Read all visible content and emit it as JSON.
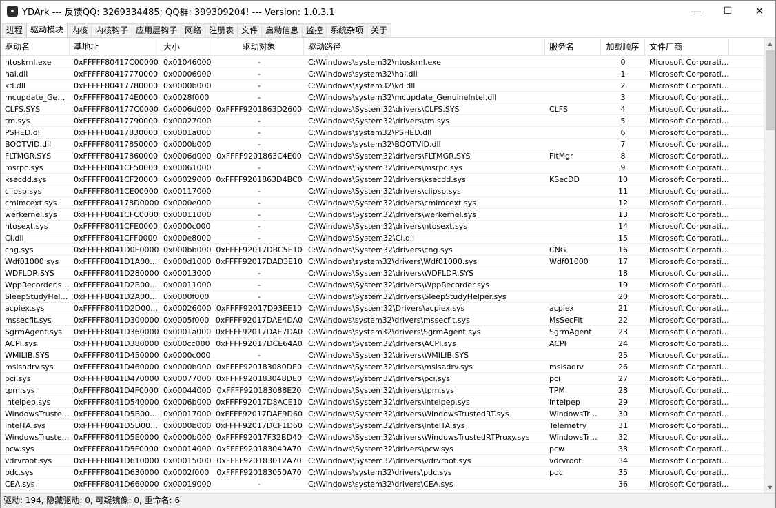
{
  "title": "YDArk --- 反馈QQ: 3269334485; QQ群: 399309204! --- Version: 1.0.3.1",
  "window_controls": {
    "minimize": "—",
    "maximize": "☐",
    "close": "✕"
  },
  "tabs": [
    "进程",
    "驱动模块",
    "内核",
    "内核钩子",
    "应用层钩子",
    "网络",
    "注册表",
    "文件",
    "启动信息",
    "监控",
    "系统杂项",
    "关于"
  ],
  "active_tab": "驱动模块",
  "columns": [
    "驱动名",
    "基地址",
    "大小",
    "驱动对象",
    "驱动路径",
    "服务名",
    "加载顺序",
    "文件厂商",
    ""
  ],
  "rows": [
    [
      "ntoskrnl.exe",
      "0xFFFFF80417C00000",
      "0x01046000",
      "-",
      "C:\\Windows\\system32\\ntoskrnl.exe",
      "",
      "0",
      "Microsoft Corporation"
    ],
    [
      "hal.dll",
      "0xFFFFF80417770000",
      "0x00006000",
      "-",
      "C:\\Windows\\system32\\hal.dll",
      "",
      "1",
      "Microsoft Corporation"
    ],
    [
      "kd.dll",
      "0xFFFFF80417780000",
      "0x0000b000",
      "-",
      "C:\\Windows\\system32\\kd.dll",
      "",
      "2",
      "Microsoft Corporation"
    ],
    [
      "mcupdate_GenuineIntel.dll",
      "0xFFFFF804174E0000",
      "0x0028f000",
      "-",
      "C:\\Windows\\system32\\mcupdate_GenuineIntel.dll",
      "",
      "3",
      "Microsoft Corporation"
    ],
    [
      "CLFS.SYS",
      "0xFFFFF804177C0000",
      "0x0006d000",
      "0xFFFF9201863D2600",
      "C:\\Windows\\System32\\drivers\\CLFS.SYS",
      "CLFS",
      "4",
      "Microsoft Corporation"
    ],
    [
      "tm.sys",
      "0xFFFFF80417790000",
      "0x00027000",
      "-",
      "C:\\Windows\\System32\\drivers\\tm.sys",
      "",
      "5",
      "Microsoft Corporation"
    ],
    [
      "PSHED.dll",
      "0xFFFFF80417830000",
      "0x0001a000",
      "-",
      "C:\\Windows\\system32\\PSHED.dll",
      "",
      "6",
      "Microsoft Corporation"
    ],
    [
      "BOOTVID.dll",
      "0xFFFFF80417850000",
      "0x0000b000",
      "-",
      "C:\\Windows\\system32\\BOOTVID.dll",
      "",
      "7",
      "Microsoft Corporation"
    ],
    [
      "FLTMGR.SYS",
      "0xFFFFF80417860000",
      "0x0006d000",
      "0xFFFF9201863C4E00",
      "C:\\Windows\\System32\\drivers\\FLTMGR.SYS",
      "FltMgr",
      "8",
      "Microsoft Corporation"
    ],
    [
      "msrpc.sys",
      "0xFFFFF8041CF50000",
      "0x00061000",
      "-",
      "C:\\Windows\\System32\\drivers\\msrpc.sys",
      "",
      "9",
      "Microsoft Corporation"
    ],
    [
      "ksecdd.sys",
      "0xFFFFF8041CF20000",
      "0x00029000",
      "0xFFFF9201863D4BC0",
      "C:\\Windows\\System32\\drivers\\ksecdd.sys",
      "KSecDD",
      "10",
      "Microsoft Corporation"
    ],
    [
      "clipsp.sys",
      "0xFFFFF8041CE00000",
      "0x00117000",
      "-",
      "C:\\Windows\\System32\\drivers\\clipsp.sys",
      "",
      "11",
      "Microsoft Corporation"
    ],
    [
      "cmimcext.sys",
      "0xFFFFF804178D0000",
      "0x0000e000",
      "-",
      "C:\\Windows\\System32\\drivers\\cmimcext.sys",
      "",
      "12",
      "Microsoft Corporation"
    ],
    [
      "werkernel.sys",
      "0xFFFFF8041CFC0000",
      "0x00011000",
      "-",
      "C:\\Windows\\System32\\drivers\\werkernel.sys",
      "",
      "13",
      "Microsoft Corporation"
    ],
    [
      "ntosext.sys",
      "0xFFFFF8041CFE0000",
      "0x0000c000",
      "-",
      "C:\\Windows\\System32\\drivers\\ntosext.sys",
      "",
      "14",
      "Microsoft Corporation"
    ],
    [
      "CI.dll",
      "0xFFFFF8041CFF0000",
      "0x000e8000",
      "-",
      "C:\\Windows\\System32\\CI.dll",
      "",
      "15",
      "Microsoft Corporation"
    ],
    [
      "cng.sys",
      "0xFFFFF8041D0E0000",
      "0x000bb000",
      "0xFFFF92017DBC5E10",
      "C:\\Windows\\System32\\drivers\\cng.sys",
      "CNG",
      "16",
      "Microsoft Corporation"
    ],
    [
      "Wdf01000.sys",
      "0xFFFFF8041D1A0000",
      "0x000d1000",
      "0xFFFF92017DAD3E10",
      "C:\\Windows\\system32\\drivers\\Wdf01000.sys",
      "Wdf01000",
      "17",
      "Microsoft Corporation"
    ],
    [
      "WDFLDR.SYS",
      "0xFFFFF8041D280000",
      "0x00013000",
      "-",
      "C:\\Windows\\System32\\drivers\\WDFLDR.SYS",
      "",
      "18",
      "Microsoft Corporation"
    ],
    [
      "WppRecorder.sys",
      "0xFFFFF8041D2B0000",
      "0x00011000",
      "-",
      "C:\\Windows\\System32\\drivers\\WppRecorder.sys",
      "",
      "19",
      "Microsoft Corporation"
    ],
    [
      "SleepStudyHelper.sys",
      "0xFFFFF8041D2A0000",
      "0x0000f000",
      "-",
      "C:\\Windows\\System32\\drivers\\SleepStudyHelper.sys",
      "",
      "20",
      "Microsoft Corporation"
    ],
    [
      "acpiex.sys",
      "0xFFFFF8041D2D0000",
      "0x00026000",
      "0xFFFF92017D93EE10",
      "C:\\Windows\\System32\\Drivers\\acpiex.sys",
      "acpiex",
      "21",
      "Microsoft Corporation"
    ],
    [
      "mssecflt.sys",
      "0xFFFFF8041D300000",
      "0x0005f000",
      "0xFFFF92017DAE4DA0",
      "C:\\Windows\\system32\\drivers\\mssecflt.sys",
      "MsSecFlt",
      "22",
      "Microsoft Corporation"
    ],
    [
      "SgrmAgent.sys",
      "0xFFFFF8041D360000",
      "0x0001a000",
      "0xFFFF92017DAE7DA0",
      "C:\\Windows\\system32\\drivers\\SgrmAgent.sys",
      "SgrmAgent",
      "23",
      "Microsoft Corporation"
    ],
    [
      "ACPI.sys",
      "0xFFFFF8041D380000",
      "0x000cc000",
      "0xFFFF92017DCE64A0",
      "C:\\Windows\\System32\\drivers\\ACPI.sys",
      "ACPI",
      "24",
      "Microsoft Corporation"
    ],
    [
      "WMILIB.SYS",
      "0xFFFFF8041D450000",
      "0x0000c000",
      "-",
      "C:\\Windows\\System32\\drivers\\WMILIB.SYS",
      "",
      "25",
      "Microsoft Corporation"
    ],
    [
      "msisadrv.sys",
      "0xFFFFF8041D460000",
      "0x0000b000",
      "0xFFFF920183080DE0",
      "C:\\Windows\\System32\\drivers\\msisadrv.sys",
      "msisadrv",
      "26",
      "Microsoft Corporation"
    ],
    [
      "pci.sys",
      "0xFFFFF8041D470000",
      "0x00077000",
      "0xFFFF920183048DE0",
      "C:\\Windows\\System32\\drivers\\pci.sys",
      "pci",
      "27",
      "Microsoft Corporation"
    ],
    [
      "tpm.sys",
      "0xFFFFF8041D4F0000",
      "0x00044000",
      "0xFFFF920183088E20",
      "C:\\Windows\\System32\\drivers\\tpm.sys",
      "TPM",
      "28",
      "Microsoft Corporation"
    ],
    [
      "intelpep.sys",
      "0xFFFFF8041D540000",
      "0x0006b000",
      "0xFFFF92017D8ACE10",
      "C:\\Windows\\System32\\drivers\\intelpep.sys",
      "intelpep",
      "29",
      "Microsoft Corporation"
    ],
    [
      "WindowsTrustedRT.sys",
      "0xFFFFF8041D5B0000",
      "0x00017000",
      "0xFFFF92017DAE9D60",
      "C:\\Windows\\System32\\drivers\\WindowsTrustedRT.sys",
      "WindowsTrustedRT",
      "30",
      "Microsoft Corporation"
    ],
    [
      "IntelTA.sys",
      "0xFFFFF8041D5D0000",
      "0x0000b000",
      "0xFFFF92017DCF1D60",
      "C:\\Windows\\System32\\drivers\\IntelTA.sys",
      "Telemetry",
      "31",
      "Microsoft Corporation"
    ],
    [
      "WindowsTrustedRTProxy.sys",
      "0xFFFFF8041D5E0000",
      "0x0000b000",
      "0xFFFF92017F32BD40",
      "C:\\Windows\\System32\\drivers\\WindowsTrustedRTProxy.sys",
      "WindowsTrustedRTProxy",
      "32",
      "Microsoft Corporation"
    ],
    [
      "pcw.sys",
      "0xFFFFF8041D5F0000",
      "0x00014000",
      "0xFFFF920183049A70",
      "C:\\Windows\\System32\\drivers\\pcw.sys",
      "pcw",
      "33",
      "Microsoft Corporation"
    ],
    [
      "vdrvroot.sys",
      "0xFFFFF8041D610000",
      "0x00015000",
      "0xFFFF920183012A70",
      "C:\\Windows\\System32\\drivers\\vdrvroot.sys",
      "vdrvroot",
      "34",
      "Microsoft Corporation"
    ],
    [
      "pdc.sys",
      "0xFFFFF8041D630000",
      "0x0002f000",
      "0xFFFF920183050A70",
      "C:\\Windows\\system32\\drivers\\pdc.sys",
      "pdc",
      "35",
      "Microsoft Corporation"
    ],
    [
      "CEA.sys",
      "0xFFFFF8041D660000",
      "0x00019000",
      "-",
      "C:\\Windows\\system32\\drivers\\CEA.sys",
      "",
      "36",
      "Microsoft Corporation"
    ]
  ],
  "status": "驱动: 194, 隐藏驱动: 0, 可疑镜像: 0, 重命名: 6"
}
